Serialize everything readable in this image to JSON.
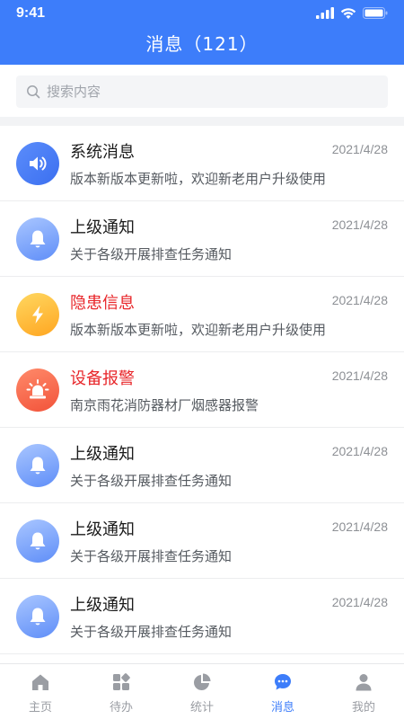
{
  "status": {
    "time": "9:41"
  },
  "header": {
    "title": "消息（121）"
  },
  "search": {
    "placeholder": "搜索内容"
  },
  "messages": [
    {
      "title": "系统消息",
      "date": "2021/4/28",
      "desc": "版本新版本更新啦，欢迎新老用户升级使用",
      "icon": "speaker-icon",
      "alert": false
    },
    {
      "title": "上级通知",
      "date": "2021/4/28",
      "desc": "关于各级开展排查任务通知",
      "icon": "bell-icon",
      "alert": false
    },
    {
      "title": "隐患信息",
      "date": "2021/4/28",
      "desc": "版本新版本更新啦，欢迎新老用户升级使用",
      "icon": "lightning-icon",
      "alert": true
    },
    {
      "title": "设备报警",
      "date": "2021/4/28",
      "desc": "南京雨花消防器材厂烟感器报警",
      "icon": "alarm-light-icon",
      "alert": true
    },
    {
      "title": "上级通知",
      "date": "2021/4/28",
      "desc": "关于各级开展排查任务通知",
      "icon": "bell-icon",
      "alert": false
    },
    {
      "title": "上级通知",
      "date": "2021/4/28",
      "desc": "关于各级开展排查任务通知",
      "icon": "bell-icon",
      "alert": false
    },
    {
      "title": "上级通知",
      "date": "2021/4/28",
      "desc": "关于各级开展排查任务通知",
      "icon": "bell-icon",
      "alert": false
    }
  ],
  "tabs": [
    {
      "label": "主页",
      "icon": "home-icon",
      "active": false
    },
    {
      "label": "待办",
      "icon": "apps-icon",
      "active": false
    },
    {
      "label": "统计",
      "icon": "pie-chart-icon",
      "active": false
    },
    {
      "label": "消息",
      "icon": "chat-icon",
      "active": true
    },
    {
      "label": "我的",
      "icon": "user-icon",
      "active": false
    }
  ],
  "colors": {
    "primary": "#3D7DFA",
    "alert": "#E8262A",
    "inactive": "#9A9DA3"
  }
}
